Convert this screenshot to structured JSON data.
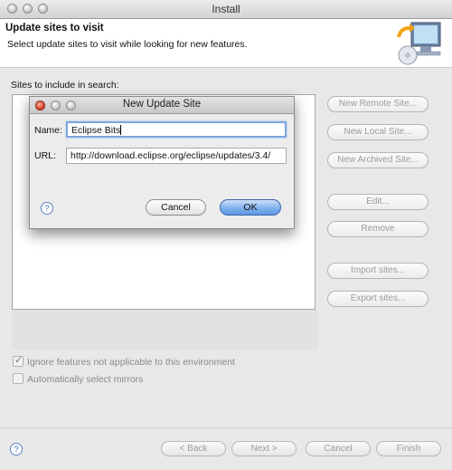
{
  "window": {
    "title": "Install"
  },
  "header": {
    "title": "Update sites to visit",
    "description": "Select update sites to visit while looking for new features."
  },
  "sites": {
    "label": "Sites to include in search:"
  },
  "side_buttons": {
    "new_remote": "New Remote Site...",
    "new_local": "New Local Site...",
    "new_archived": "New Archived Site...",
    "edit": "Edit...",
    "remove": "Remove",
    "import": "Import sites...",
    "export": "Export sites..."
  },
  "options": {
    "ignore_label": "Ignore features not applicable to this environment",
    "ignore_checked": true,
    "mirrors_label": "Automatically select mirrors",
    "mirrors_checked": false
  },
  "footer": {
    "back": "< Back",
    "next": "Next >",
    "cancel": "Cancel",
    "finish": "Finish",
    "help": "?"
  },
  "dialog": {
    "title": "New Update Site",
    "name_label": "Name:",
    "name_value": "Eclipse Bits",
    "url_label": "URL:",
    "url_value": "http://download.eclipse.org/eclipse/updates/3.4/",
    "cancel": "Cancel",
    "ok": "OK",
    "help": "?"
  },
  "colors": {
    "accent": "#5d97e3",
    "window_bg": "#e8e8e8"
  }
}
